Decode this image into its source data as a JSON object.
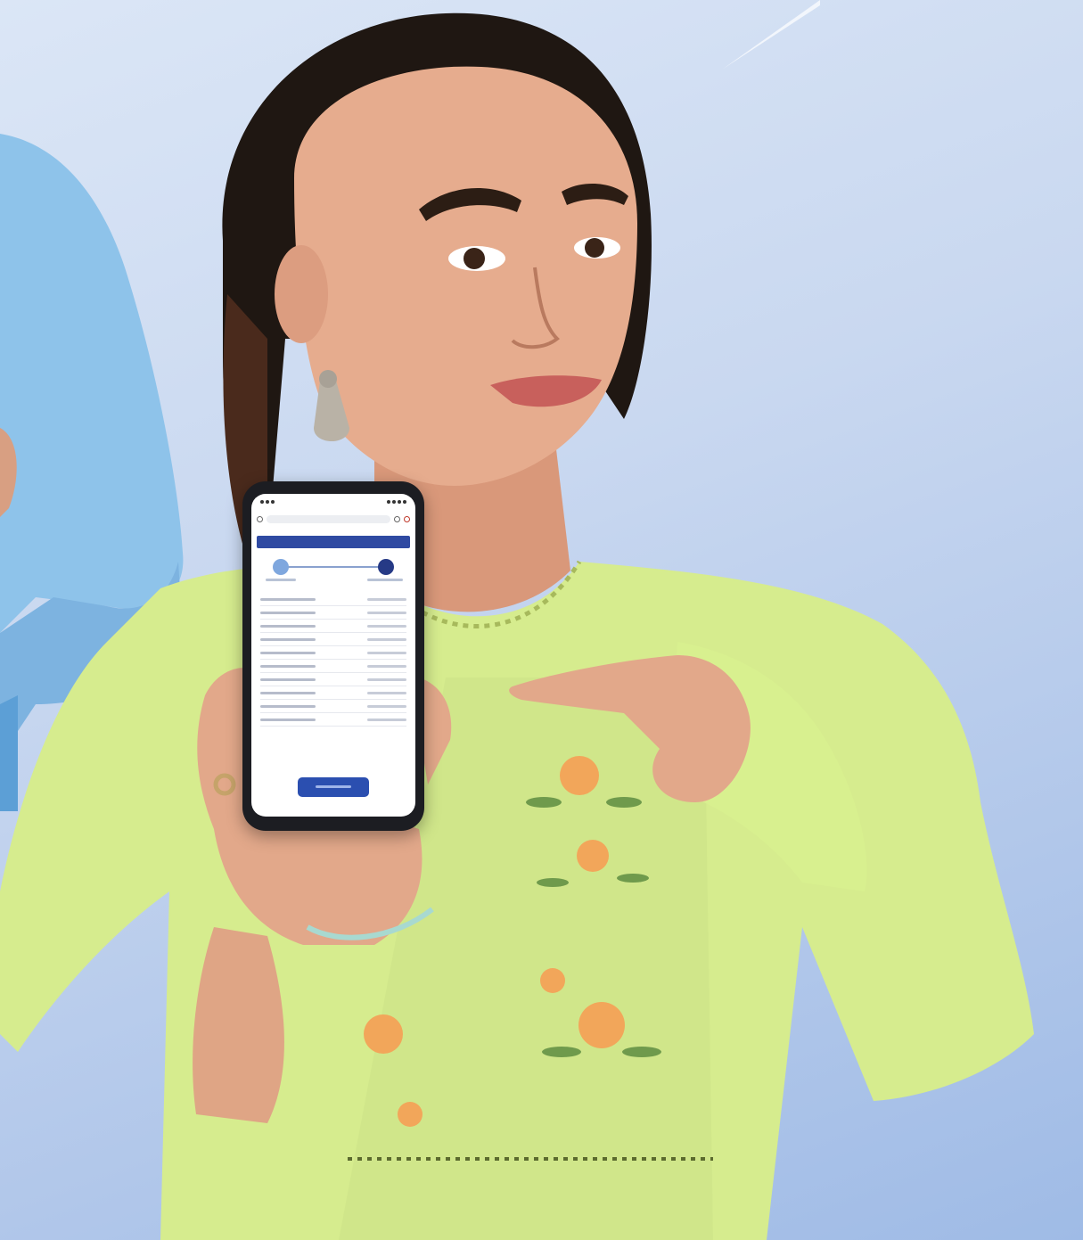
{
  "colors": {
    "background": "#c9d8f0",
    "kurta": "#d6ec8e",
    "embroidery": "#f2a65a",
    "hair": "#1f1712",
    "skin": "#e2a98a",
    "shirt_left": "#8ec3ea",
    "phone_body": "#1c1d22",
    "phone_header": "#2f4aa2",
    "phone_button": "#2b4fb0"
  },
  "phone": {
    "icons": [
      "back-icon",
      "lock-icon",
      "share-icon",
      "menu-icon"
    ]
  }
}
